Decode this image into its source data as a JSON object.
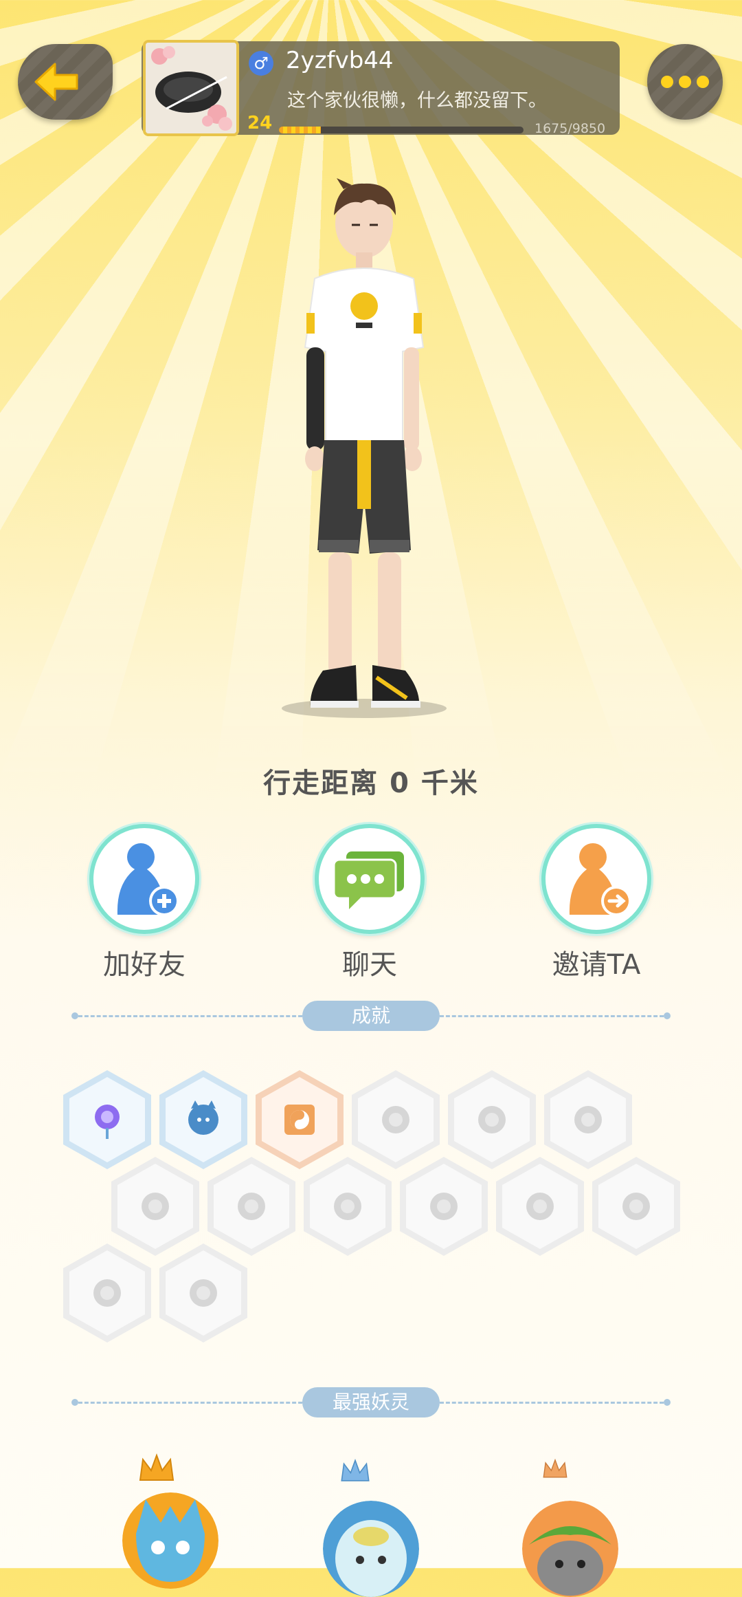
{
  "header": {
    "back_icon": "arrow-left-icon",
    "more_icon": "more-dots-icon",
    "accent_color": "#ffd21e"
  },
  "profile": {
    "gender_symbol": "♂",
    "username": "2yzfvb44",
    "signature": "这个家伙很懒，什么都没留下。",
    "level": "24",
    "xp_text": "1675/9850",
    "xp_progress": 0.17
  },
  "stats": {
    "distance": "行走距离 0 千米"
  },
  "actions": {
    "add_friend": "加好友",
    "chat": "聊天",
    "invite": "邀请TA"
  },
  "sections": {
    "achievements": "成就",
    "strongest_spirits": "最强妖灵"
  },
  "achievements": [
    {
      "icon": "lollipop-target-icon",
      "state": "earned-blue"
    },
    {
      "icon": "cat-chat-icon",
      "state": "earned-blue"
    },
    {
      "icon": "yin-yang-book-icon",
      "state": "earned-orange"
    },
    {
      "icon": "sneaker-icon",
      "state": "locked"
    },
    {
      "icon": "moon-icon",
      "state": "locked"
    },
    {
      "icon": "pokeball-icon",
      "state": "locked"
    },
    {
      "icon": "crystal-icon",
      "state": "locked"
    },
    {
      "icon": "taiji-wave-icon",
      "state": "locked"
    },
    {
      "icon": "fox-spirit-icon",
      "state": "locked"
    },
    {
      "icon": "cart-cat-icon",
      "state": "locked"
    },
    {
      "icon": "panda-balloon-icon",
      "state": "locked"
    },
    {
      "icon": "dragon-wave-icon",
      "state": "locked"
    },
    {
      "icon": "stone-drum-icon",
      "state": "locked"
    },
    {
      "icon": "fox-book-icon",
      "state": "locked"
    }
  ]
}
